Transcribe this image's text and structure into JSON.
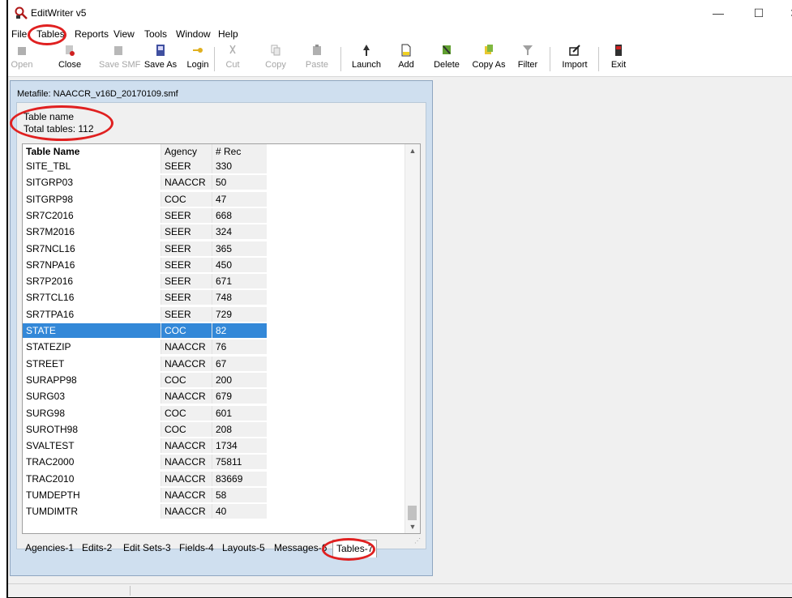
{
  "window": {
    "title": "EditWriter v5",
    "minimize": "—",
    "maximize": "☐",
    "close": "✕"
  },
  "menu": [
    "File",
    "Tables",
    "Reports",
    "View",
    "Tools",
    "Window",
    "Help"
  ],
  "toolbar": [
    {
      "label": "Open",
      "icon": "open-icon",
      "enabled": false
    },
    {
      "label": "Close",
      "icon": "close-file-icon",
      "enabled": true
    },
    {
      "label": "Save SMF",
      "icon": "save-smf-icon",
      "enabled": false
    },
    {
      "label": "Save As",
      "icon": "save-as-icon",
      "enabled": true
    },
    {
      "label": "Login",
      "icon": "login-key-icon",
      "enabled": true
    },
    {
      "label": "Cut",
      "icon": "cut-icon",
      "enabled": false
    },
    {
      "label": "Copy",
      "icon": "copy-icon",
      "enabled": false
    },
    {
      "label": "Paste",
      "icon": "paste-icon",
      "enabled": false
    },
    {
      "label": "Launch",
      "icon": "launch-icon",
      "enabled": true
    },
    {
      "label": "Add",
      "icon": "add-icon",
      "enabled": true
    },
    {
      "label": "Delete",
      "icon": "delete-icon",
      "enabled": true
    },
    {
      "label": "Copy As",
      "icon": "copy-as-icon",
      "enabled": true
    },
    {
      "label": "Filter",
      "icon": "filter-icon",
      "enabled": true
    },
    {
      "label": "Import",
      "icon": "import-icon",
      "enabled": true
    },
    {
      "label": "Exit",
      "icon": "exit-icon",
      "enabled": true
    }
  ],
  "child": {
    "title": "Metafile: NAACCR_v16D_20170109.smf",
    "label": "Table name",
    "total": "Total tables: 112"
  },
  "grid": {
    "headers": [
      "Table Name",
      "Agency",
      "# Rec"
    ],
    "selected_index": 10,
    "rows": [
      [
        "SITE_TBL",
        "SEER",
        "330"
      ],
      [
        "SITGRP03",
        "NAACCR",
        "50"
      ],
      [
        "SITGRP98",
        "COC",
        "47"
      ],
      [
        "SR7C2016",
        "SEER",
        "668"
      ],
      [
        "SR7M2016",
        "SEER",
        "324"
      ],
      [
        "SR7NCL16",
        "SEER",
        "365"
      ],
      [
        "SR7NPA16",
        "SEER",
        "450"
      ],
      [
        "SR7P2016",
        "SEER",
        "671"
      ],
      [
        "SR7TCL16",
        "SEER",
        "748"
      ],
      [
        "SR7TPA16",
        "SEER",
        "729"
      ],
      [
        "STATE",
        "COC",
        "82"
      ],
      [
        "STATEZIP",
        "NAACCR",
        "76"
      ],
      [
        "STREET",
        "NAACCR",
        "67"
      ],
      [
        "SURAPP98",
        "COC",
        "200"
      ],
      [
        "SURG03",
        "NAACCR",
        "679"
      ],
      [
        "SURG98",
        "COC",
        "601"
      ],
      [
        "SUROTH98",
        "COC",
        "208"
      ],
      [
        "SVALTEST",
        "NAACCR",
        "1734"
      ],
      [
        "TRAC2000",
        "NAACCR",
        "75811"
      ],
      [
        "TRAC2010",
        "NAACCR",
        "83669"
      ],
      [
        "TUMDEPTH",
        "NAACCR",
        "58"
      ],
      [
        "TUMDIMTR",
        "NAACCR",
        "40"
      ]
    ]
  },
  "tabs": [
    "Agencies-1",
    "Edits-2",
    "Edit Sets-3",
    "Fields-4",
    "Layouts-5",
    "Messages-6",
    "Tables-7"
  ],
  "active_tab": "Tables-7",
  "colors": {
    "selection": "#3388d8",
    "annotation_ring": "#e02020",
    "mdi_frame": "#cfdfef"
  }
}
